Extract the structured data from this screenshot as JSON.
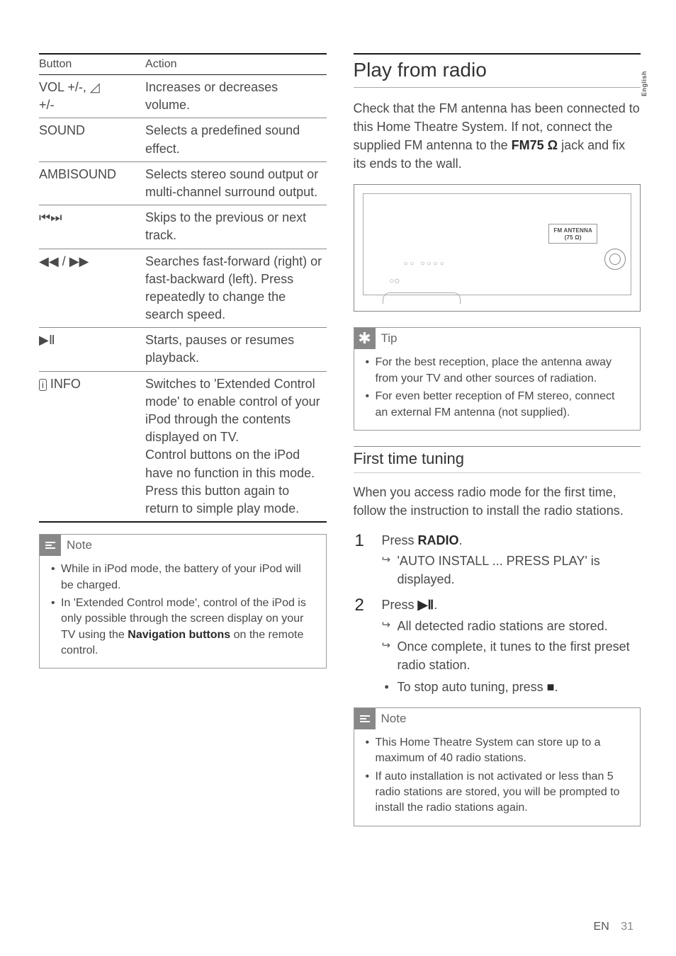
{
  "sideTab": "English",
  "table": {
    "headers": {
      "button": "Button",
      "action": "Action"
    },
    "rows": [
      {
        "button_html": "VOL +/-, <span class='sym'>◿</span><br>+/-",
        "action": "Increases or decreases volume."
      },
      {
        "button_html": "SOUND",
        "action": "Selects a predefined sound effect."
      },
      {
        "button_html": "AMBISOUND",
        "action": "Selects stereo sound output or multi-channel surround output."
      },
      {
        "button_html": "<span class='sym'>⏮⏭</span>",
        "action": "Skips to the previous or next track."
      },
      {
        "button_html": "<span class='sym'>◀◀ / ▶▶</span>",
        "action": "Searches fast-forward (right) or fast-backward (left). Press repeatedly to change the search speed."
      },
      {
        "button_html": "<span class='sym'>▶Ⅱ</span>",
        "action": "Starts, pauses or resumes playback."
      },
      {
        "button_html": "<span class='sym' style='font-size:13px;border:1px solid #555;border-radius:3px;padding:0 3px;'>i</span> INFO",
        "action": "Switches to 'Extended Control mode' to enable control of your iPod through the contents displayed on TV.\nControl buttons on the iPod have no function in this mode.\nPress this button again to return to simple play mode."
      }
    ]
  },
  "note1": {
    "title": "Note",
    "items": [
      "While in iPod mode, the battery of your iPod will be charged.",
      "In 'Extended Control mode', control of the iPod is only possible through the screen display on your TV using the <span class='bold'>Navigation buttons</span> on the remote control."
    ]
  },
  "right": {
    "h1": "Play from radio",
    "intro": "Check that the FM antenna has been connected to this Home Theatre System. If not, connect the supplied FM antenna to the <span class='bold'>FM75 Ω</span> jack and fix its ends to the wall.",
    "antenna_label1": "FM ANTENNA",
    "antenna_label2": "(75 Ω)",
    "tip": {
      "title": "Tip",
      "items": [
        "For the best reception, place the antenna away from your TV and other sources of radiation.",
        "For even better reception of FM stereo, connect an external FM antenna (not supplied)."
      ]
    },
    "h2": "First time tuning",
    "intro2": "When you access radio mode for the first time, follow the instruction to install the radio stations.",
    "steps": [
      {
        "text": "Press <span class='bold'>RADIO</span>.",
        "subs": [
          {
            "type": "arrow",
            "text": "'AUTO INSTALL ... PRESS PLAY' is displayed."
          }
        ]
      },
      {
        "text": "Press <span class='sym bold'>▶Ⅱ</span>.",
        "subs": [
          {
            "type": "arrow",
            "text": "All detected radio stations are stored."
          },
          {
            "type": "arrow",
            "text": "Once complete, it tunes to the first preset radio station."
          },
          {
            "type": "bullet",
            "text": "To stop auto tuning, press <span class='sym bold'>■</span>."
          }
        ]
      }
    ],
    "note2": {
      "title": "Note",
      "items": [
        "This Home Theatre System can store up to a maximum of 40 radio stations.",
        "If auto installation is not activated or less than 5 radio stations are stored, you will be prompted to install the radio stations again."
      ]
    }
  },
  "footer": {
    "lang": "EN",
    "page": "31"
  }
}
